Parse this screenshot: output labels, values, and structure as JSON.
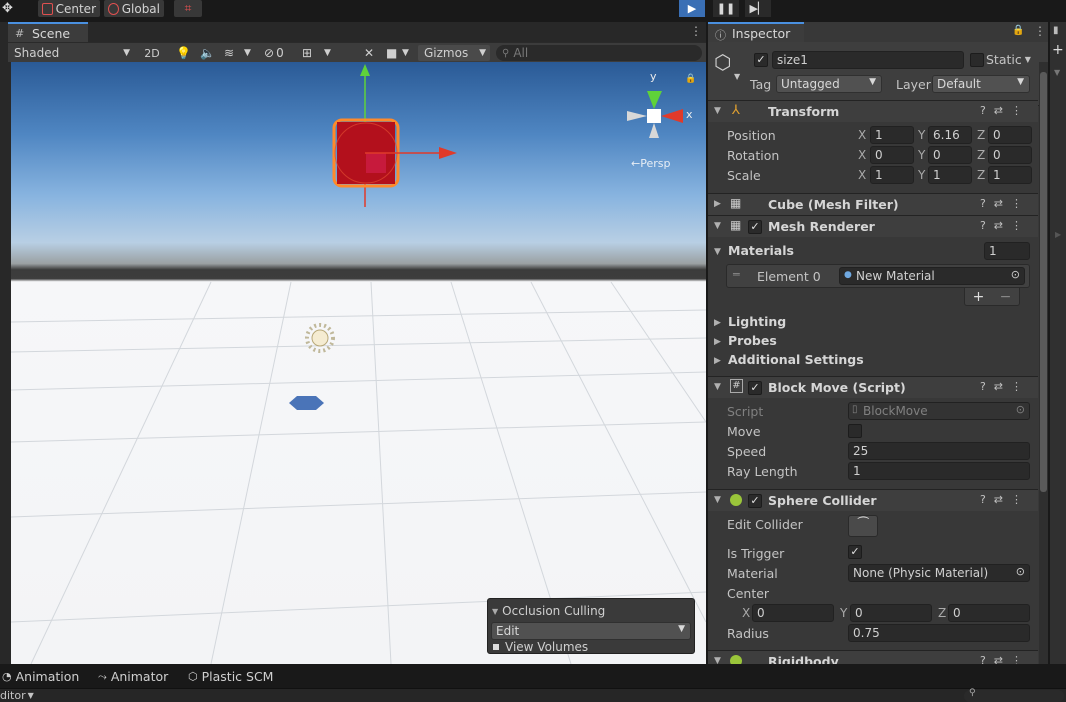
{
  "toolbar": {
    "pivot_label": "Center",
    "space_label": "Global"
  },
  "scene": {
    "tab_label": "Scene",
    "shading_mode": "Shaded",
    "mode_2d": "2D",
    "hidden_count": "0",
    "gizmos_label": "Gizmos",
    "search_placeholder": "All",
    "persp_label": "←Persp",
    "gizmo_axes": {
      "y": "y",
      "x": "x"
    }
  },
  "occlusion": {
    "title": "Occlusion Culling",
    "mode": "Edit",
    "view_volumes": "View Volumes"
  },
  "inspector": {
    "tab_label": "Inspector",
    "object_name": "size1",
    "static_label": "Static",
    "tag_label": "Tag",
    "tag_value": "Untagged",
    "layer_label": "Layer",
    "layer_value": "Default",
    "transform": {
      "title": "Transform",
      "position_label": "Position",
      "rotation_label": "Rotation",
      "scale_label": "Scale",
      "axis_x": "X",
      "axis_y": "Y",
      "axis_z": "Z",
      "position": {
        "x": "1",
        "y": "6.16",
        "z": "0"
      },
      "rotation": {
        "x": "0",
        "y": "0",
        "z": "0"
      },
      "scale": {
        "x": "1",
        "y": "1",
        "z": "1"
      }
    },
    "mesh_filter": {
      "title": "Cube (Mesh Filter)"
    },
    "mesh_renderer": {
      "title": "Mesh Renderer",
      "materials_label": "Materials",
      "materials_count": "1",
      "element_label": "Element 0",
      "element_value": "New Material",
      "plus": "+",
      "minus": "−",
      "lighting": "Lighting",
      "probes": "Probes",
      "additional": "Additional Settings"
    },
    "block_move": {
      "title": "Block Move (Script)",
      "script_label": "Script",
      "script_value": "BlockMove",
      "move_label": "Move",
      "speed_label": "Speed",
      "speed_value": "25",
      "ray_label": "Ray Length",
      "ray_value": "1"
    },
    "sphere_collider": {
      "title": "Sphere Collider",
      "edit_label": "Edit Collider",
      "trigger_label": "Is Trigger",
      "material_label": "Material",
      "material_value": "None (Physic Material)",
      "center_label": "Center",
      "center": {
        "x": "0",
        "y": "0",
        "z": "0"
      },
      "radius_label": "Radius",
      "radius_value": "0.75"
    },
    "rigidbody": {
      "title": "Rigidbody"
    }
  },
  "bottom": {
    "animation": "Animation",
    "animator": "Animator",
    "plastic": "Plastic SCM",
    "status_left": "ditor"
  },
  "colors": {
    "accent_blue": "#4a90e0",
    "cube_red": "#b3101c",
    "outline_orange": "#ff7a1a",
    "axis_green": "#5fd23a",
    "axis_red": "#e03a2a"
  }
}
